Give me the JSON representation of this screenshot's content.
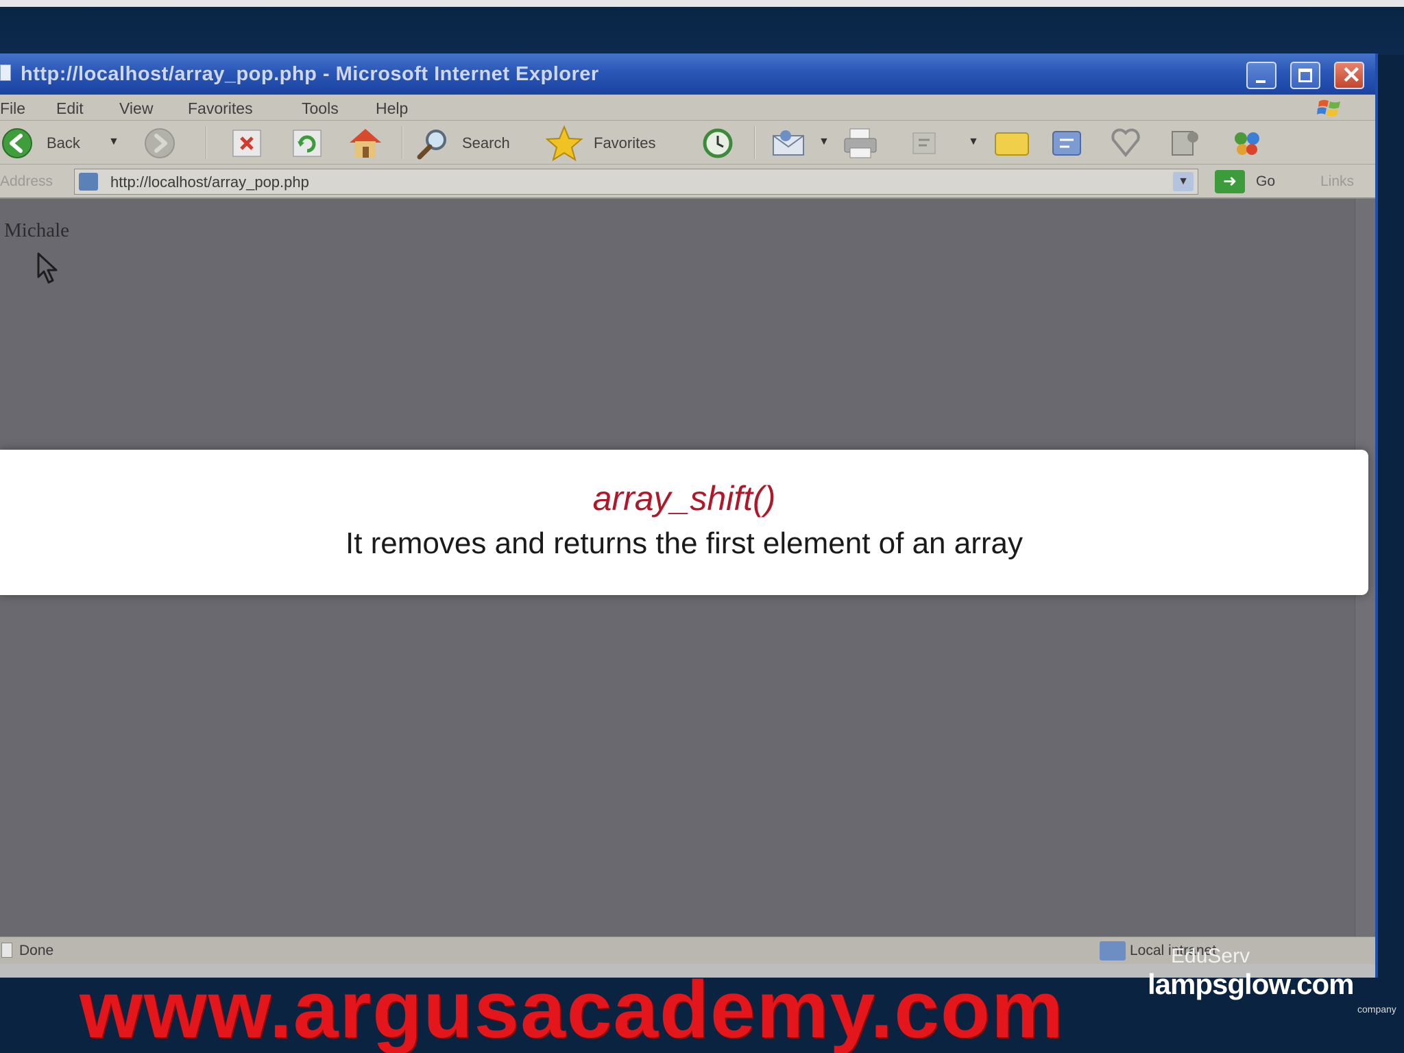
{
  "window": {
    "title": "http://localhost/array_pop.php - Microsoft Internet Explorer"
  },
  "menubar": {
    "items": [
      "File",
      "Edit",
      "View",
      "Favorites",
      "Tools",
      "Help"
    ]
  },
  "toolbar": {
    "back_label": "Back",
    "search_label": "Search",
    "favorites_label": "Favorites"
  },
  "addressbar": {
    "label": "Address",
    "url": "http://localhost/array_pop.php",
    "go_label": "Go",
    "links_label": "Links"
  },
  "page": {
    "output_text": "Michale"
  },
  "statusbar": {
    "status_text": "Done",
    "zone_text": "Local intranet"
  },
  "overlay": {
    "function_name": "array_shift()",
    "description": "It removes and returns the first element of an array"
  },
  "watermarks": {
    "site_url": "www.argusacademy.com",
    "logo_top": "EduServ",
    "logo_main": "lampsglow.com",
    "logo_sub": "company"
  },
  "colors": {
    "accent_red": "#b0182a",
    "watermark_red": "#e3161c",
    "xp_titlebar_blue": "#2a57b7"
  }
}
